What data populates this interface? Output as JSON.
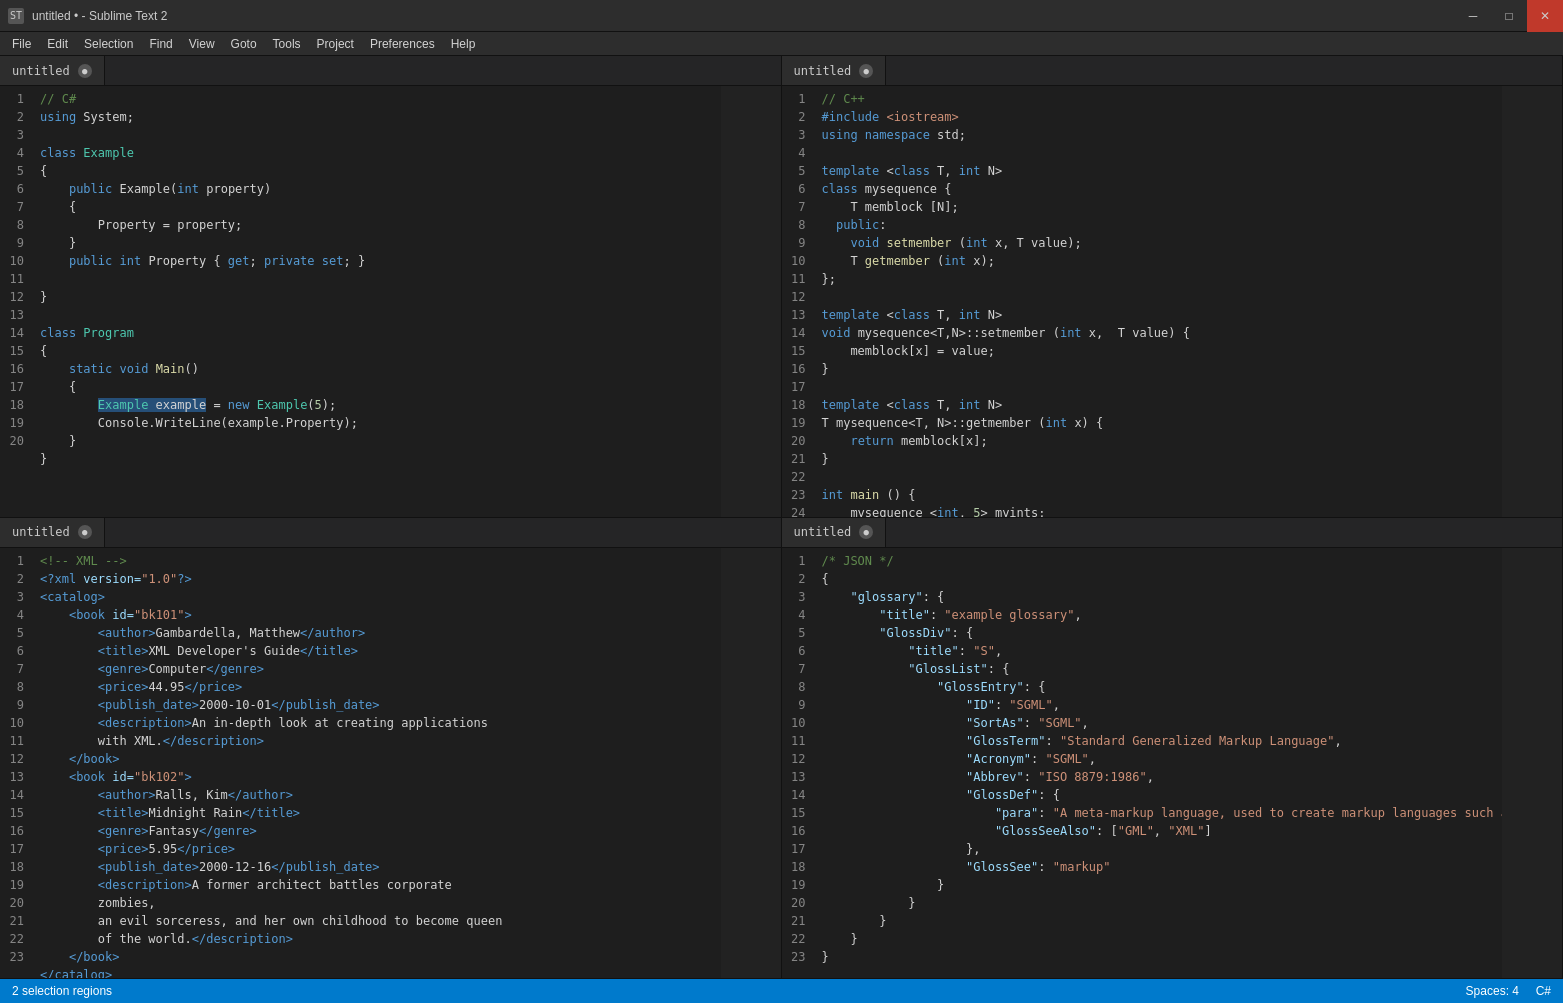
{
  "titleBar": {
    "title": "untitled • - Sublime Text 2",
    "appIconLabel": "ST",
    "minimizeLabel": "─",
    "restoreLabel": "□",
    "closeLabel": "✕"
  },
  "menuBar": {
    "items": [
      "File",
      "Edit",
      "Selection",
      "Find",
      "View",
      "Goto",
      "Tools",
      "Project",
      "Preferences",
      "Help"
    ]
  },
  "panes": [
    {
      "id": "pane-topleft",
      "tab": "untitled",
      "lang": "csharp"
    },
    {
      "id": "pane-topright",
      "tab": "untitled",
      "lang": "cpp"
    },
    {
      "id": "pane-bottomleft",
      "tab": "untitled",
      "lang": "xml"
    },
    {
      "id": "pane-bottomright",
      "tab": "untitled",
      "lang": "json"
    }
  ],
  "statusBar": {
    "left": "2 selection regions",
    "right": "Spaces: 4",
    "language": "C#"
  }
}
